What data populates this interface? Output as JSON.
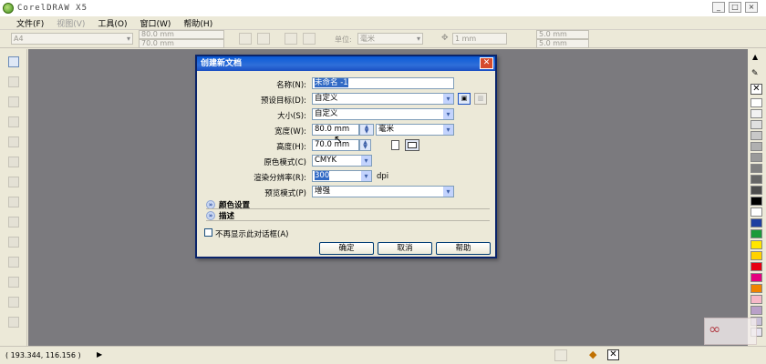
{
  "window": {
    "title": "CorelDRAW X5",
    "controls": {
      "minimize": "_",
      "maximize": "□",
      "close": "×"
    }
  },
  "menubar": {
    "items": [
      {
        "label": "文件(F)",
        "enabled": true
      },
      {
        "label": "视图(V)",
        "enabled": false
      },
      {
        "label": "工具(O)",
        "enabled": true
      },
      {
        "label": "窗口(W)",
        "enabled": true
      },
      {
        "label": "帮助(H)",
        "enabled": true
      }
    ]
  },
  "propbar": {
    "paper": "A4",
    "width": "80.0 mm",
    "height": "70.0 mm",
    "units_label": "单位:",
    "units": "毫米",
    "nudge": "1 mm",
    "dup_x": "5.0 mm",
    "dup_y": "5.0 mm"
  },
  "status": {
    "coords": "( 193.344, 116.156 )",
    "arrow": "▶"
  },
  "dialog": {
    "title": "创建新文档",
    "close": "✕",
    "fields": {
      "name": {
        "label": "名称(N):",
        "value": "未命名 -1"
      },
      "preset": {
        "label": "预设目标(D):",
        "value": "自定义"
      },
      "size": {
        "label": "大小(S):",
        "value": "自定义"
      },
      "width": {
        "label": "宽度(W):",
        "value": "80.0 mm",
        "unit": "毫米"
      },
      "height": {
        "label": "高度(H):",
        "value": "70.0 mm"
      },
      "color_mode": {
        "label": "原色模式(C)",
        "value": "CMYK"
      },
      "resolution": {
        "label": "渲染分辨率(R):",
        "value": "300",
        "unit": "dpi"
      },
      "preview": {
        "label": "预览模式(P)",
        "value": "增强"
      }
    },
    "sections": {
      "color_settings": "颜色设置",
      "description": "描述"
    },
    "dont_show": "不再显示此对话框(A)",
    "buttons": {
      "ok": "确定",
      "cancel": "取消",
      "help": "帮助"
    }
  },
  "palette_colors": [
    "#ffffff",
    "#f2f2f2",
    "#e0e0e0",
    "#c8c8c8",
    "#b0b0b0",
    "#9a9a9a",
    "#808080",
    "#666666",
    "#4d4d4d",
    "#000000",
    "#ffffff",
    "#1f3fa0",
    "#1a9a3a",
    "#ffe600",
    "#ffd200",
    "#e60012",
    "#e4007f",
    "#f08300",
    "#f6b8c8",
    "#b9a0c8",
    "#c8c0d8",
    "#e8e4f0"
  ]
}
